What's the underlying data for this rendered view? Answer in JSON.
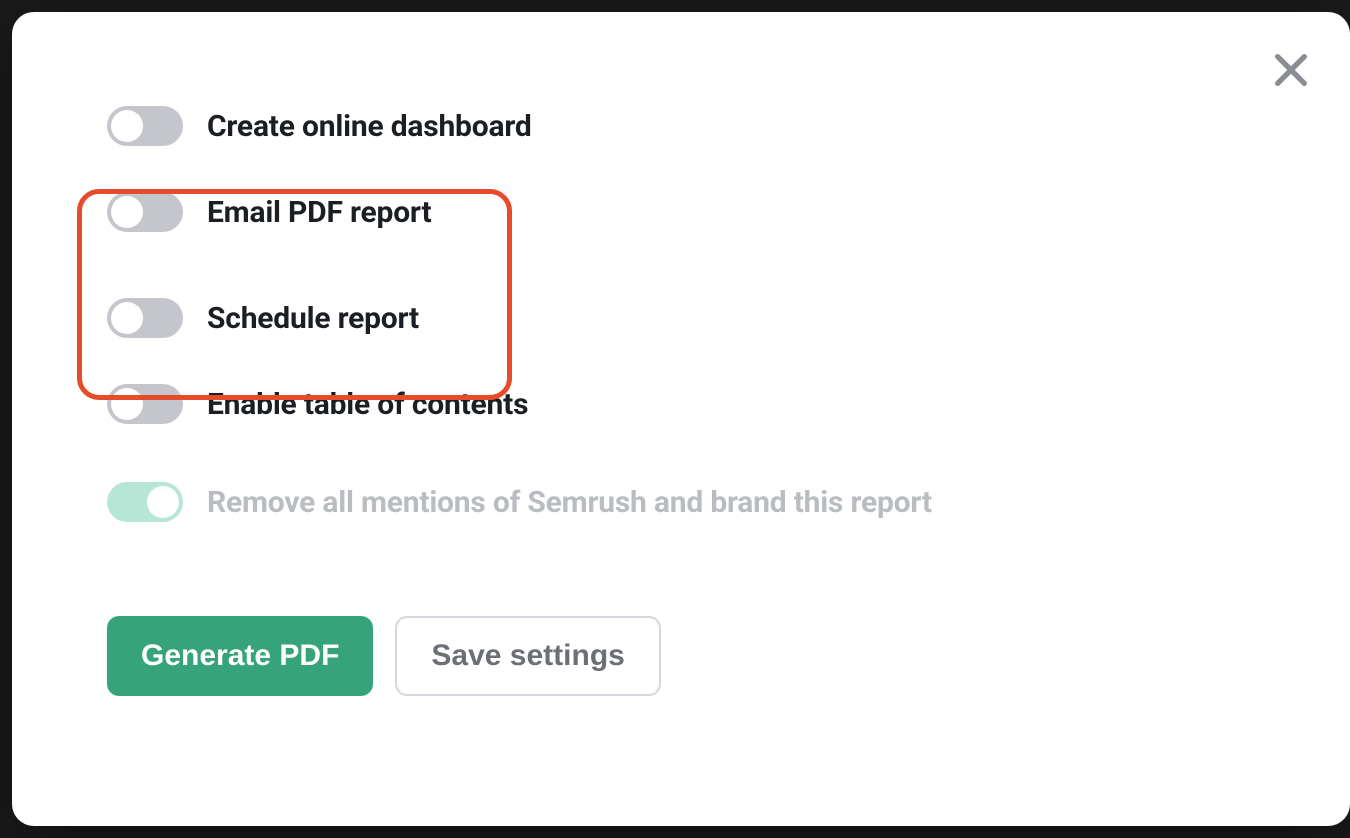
{
  "toggles": {
    "create_dashboard": "Create online dashboard",
    "email_pdf": "Email PDF report",
    "schedule_report": "Schedule report",
    "enable_toc": "Enable table of contents",
    "remove_brand": "Remove all mentions of Semrush and brand this report"
  },
  "buttons": {
    "generate": "Generate PDF",
    "save": "Save settings"
  }
}
